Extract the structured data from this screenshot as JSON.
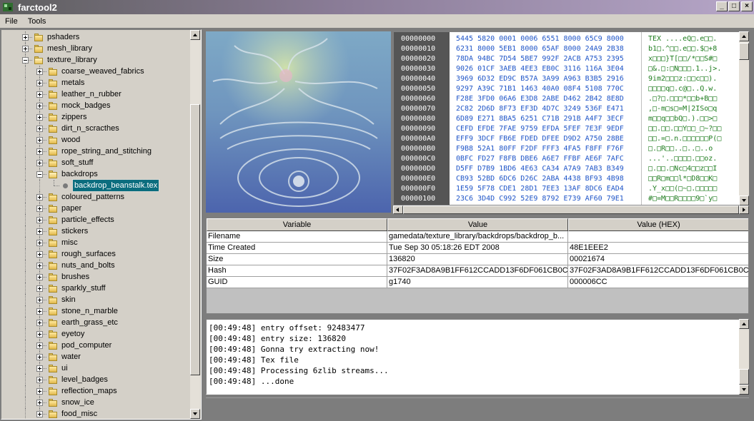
{
  "window": {
    "title": "farctool2",
    "accent": "#0b6d7e"
  },
  "menubar": {
    "file": "File",
    "tools": "Tools"
  },
  "tree": {
    "root_items": [
      {
        "label": "pshaders",
        "expanded": false
      },
      {
        "label": "mesh_library",
        "expanded": false
      },
      {
        "label": "texture_library",
        "expanded": true
      }
    ],
    "texture_children": [
      {
        "label": "coarse_weaved_fabrics"
      },
      {
        "label": "metals"
      },
      {
        "label": "leather_n_rubber"
      },
      {
        "label": "mock_badges"
      },
      {
        "label": "zippers"
      },
      {
        "label": "dirt_n_scracthes"
      },
      {
        "label": "wood"
      },
      {
        "label": "rope_string_and_stitching"
      },
      {
        "label": "soft_stuff"
      },
      {
        "label": "backdrops",
        "expanded": true
      },
      {
        "label": "backdrop_beanstalk.tex",
        "file": true,
        "selected": true
      },
      {
        "label": "coloured_patterns"
      },
      {
        "label": "paper"
      },
      {
        "label": "particle_effects"
      },
      {
        "label": "stickers"
      },
      {
        "label": "misc"
      },
      {
        "label": "rough_surfaces"
      },
      {
        "label": "nuts_and_bolts"
      },
      {
        "label": "brushes"
      },
      {
        "label": "sparkly_stuff"
      },
      {
        "label": "skin"
      },
      {
        "label": "stone_n_marble"
      },
      {
        "label": "earth_grass_etc"
      },
      {
        "label": "eyetoy"
      },
      {
        "label": "pod_computer"
      },
      {
        "label": "water"
      },
      {
        "label": "ui"
      },
      {
        "label": "level_badges"
      },
      {
        "label": "reflection_maps"
      },
      {
        "label": "snow_ice"
      },
      {
        "label": "food_misc"
      }
    ]
  },
  "hex": {
    "rows": [
      {
        "addr": "00000000",
        "bytes": "5445 5820 0001 0006 6551 8000 65C9 8000",
        "ascii": "TEX ....eQ□.e□□."
      },
      {
        "addr": "00000010",
        "bytes": "6231 8000 5EB1 8000 65AF 8000 24A9 2B38",
        "ascii": "b1□.^□□.e□□.$□+8"
      },
      {
        "addr": "00000020",
        "bytes": "78DA 94BC 7D54 5BE7 992F 2ACB A753 2395",
        "ascii": "x□□□}T[□□/*□□S#□"
      },
      {
        "addr": "00000030",
        "bytes": "9026 01CF 3AEB 4EE3 EB0C 3116 116A 3E04",
        "ascii": "□&.□:□N□□□.1..j>."
      },
      {
        "addr": "00000040",
        "bytes": "3969 6D32 ED9C B57A 3A99 A963 B3B5 2916",
        "ascii": "9im2□□□z:□□c□□)."
      },
      {
        "addr": "00000050",
        "bytes": "9297 A39C 71B1 1463 40A0 08F4 5108 770C",
        "ascii": "□□□□q□.c@□..Q.w."
      },
      {
        "addr": "00000060",
        "bytes": "F28E 3FD0 06A6 E3D8 2ABE D462 2B42 8E8D",
        "ascii": ".□?□.□□□*□□b+B□□"
      },
      {
        "addr": "00000070",
        "bytes": "2C82 2D6D 8F73 EF3D 4D7C 3249 536F E471",
        "ascii": ",□-m□s□=M|2ISo□q"
      },
      {
        "addr": "00000080",
        "bytes": "6D89 E271 8BA5 6251 C71B 291B A4F7 3ECF",
        "ascii": "m□□q□□bQ□.).□□>□"
      },
      {
        "addr": "00000090",
        "bytes": "CEFD EFDE 7FAE 9759 EFDA 5FEF 7E3F 9EDF",
        "ascii": "□□.□□.□□Y□□_□~?□□"
      },
      {
        "addr": "000000A0",
        "bytes": "EFF9 3DCF FB6E FDED DFEE D9D2 A750 28BE",
        "ascii": "□□.=□.n.□□□□□□P(□"
      },
      {
        "addr": "000000B0",
        "bytes": "F9B8 52A1 80FF F2DF FFF3 4FA5 F8FF F76F",
        "ascii": "□.□R□□..□..□..o"
      },
      {
        "addr": "000000C0",
        "bytes": "0BFC FD27 F8FB DBE6 A6E7 FFBF AE6F 7AFC",
        "ascii": "...'..□□□□.□□oz."
      },
      {
        "addr": "000000D0",
        "bytes": "D5FF D7B9 1BD6 4E63 CA34 A7A9 7AB3 B349",
        "ascii": "□.□□.□Nc□4□□z□□I"
      },
      {
        "addr": "000000E0",
        "bytes": "CB93 52BD 6DC6 D26C 2ABA 4438 BF93 4B98",
        "ascii": "□□R□m□□l*□D8□□K□"
      },
      {
        "addr": "000000F0",
        "bytes": "1E59 5F78 CDE1 28D1 7EE3 13AF 8DC6 EAD4",
        "ascii": ".Y_x□□(□~□.□□□□□"
      },
      {
        "addr": "00000100",
        "bytes": "23C6 3D4D C992 52E9 8792 E739 AF60 79E1",
        "ascii": "#□=M□□R□□□□9□`y□"
      }
    ]
  },
  "properties": {
    "headers": [
      "Variable",
      "Value",
      "Value (HEX)"
    ],
    "rows": [
      [
        "Filename",
        "gamedata/texture_library/backdrops/backdrop_b...",
        ""
      ],
      [
        "Time Created",
        "Tue Sep 30 05:18:26 EDT 2008",
        "48E1EEE2"
      ],
      [
        "Size",
        "136820",
        "00021674"
      ],
      [
        "Hash",
        "37F02F3AD8A9B1FF612CCADD13F6DF061CB0C...",
        "37F02F3AD8A9B1FF612CCADD13F6DF061CB0C..."
      ],
      [
        "GUID",
        "g1740",
        "000006CC"
      ]
    ]
  },
  "log": {
    "lines": [
      "[00:49:48] entry offset: 92483477",
      "[00:49:48] entry size: 136820",
      "[00:49:48] Gonna try extracting now!",
      "[00:49:48] Tex file",
      "[00:49:48] Processing 6zlib streams...",
      "[00:49:48] ...done"
    ]
  }
}
